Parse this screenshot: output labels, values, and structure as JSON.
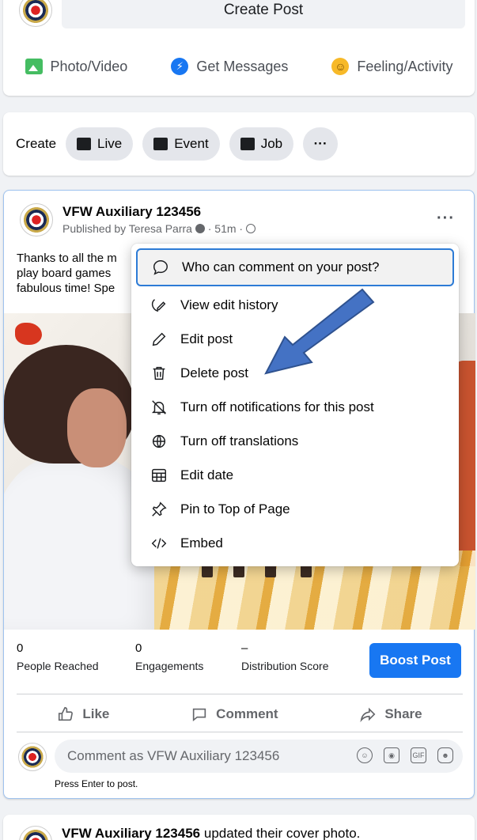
{
  "create_card": {
    "title": "Create Post",
    "actions": [
      {
        "label": "Photo/Video",
        "icon": "photo-icon"
      },
      {
        "label": "Get Messages",
        "icon": "messenger-icon"
      },
      {
        "label": "Feeling/Activity",
        "icon": "smiley-icon"
      }
    ]
  },
  "create_row": {
    "label": "Create",
    "pills": [
      {
        "label": "Live",
        "icon": "live-video-icon"
      },
      {
        "label": "Event",
        "icon": "calendar-icon"
      },
      {
        "label": "Job",
        "icon": "briefcase-icon"
      }
    ],
    "more": "···"
  },
  "post": {
    "author": "VFW Auxiliary 123456",
    "meta": "Published by Teresa Parra",
    "time": "51m",
    "more": "···",
    "text_lines": [
      "Thanks to all the m",
      "play board games",
      "fabulous time! Spe"
    ],
    "stats": [
      {
        "value": "0",
        "label": "People Reached"
      },
      {
        "value": "0",
        "label": "Engagements"
      },
      {
        "value": "–",
        "label": "Distribution Score"
      }
    ],
    "boost_label": "Boost Post",
    "reactions": [
      "Like",
      "Comment",
      "Share"
    ],
    "comment_placeholder": "Comment as VFW Auxiliary 123456",
    "enter_hint": "Press Enter to post."
  },
  "menu": {
    "items": [
      {
        "label": "Who can comment on your post?",
        "icon": "comment-bubble-icon"
      },
      {
        "label": "View edit history",
        "icon": "history-icon"
      },
      {
        "label": "Edit post",
        "icon": "pencil-icon"
      },
      {
        "label": "Delete post",
        "icon": "trash-icon"
      },
      {
        "label": "Turn off notifications for this post",
        "icon": "bell-off-icon"
      },
      {
        "label": "Turn off translations",
        "icon": "globe-icon"
      },
      {
        "label": "Edit date",
        "icon": "calendar-icon"
      },
      {
        "label": "Pin to Top of Page",
        "icon": "pin-icon"
      },
      {
        "label": "Embed",
        "icon": "code-icon"
      }
    ]
  },
  "next_post": {
    "author": "VFW Auxiliary 123456",
    "action": "updated their cover photo."
  },
  "colors": {
    "brand_blue": "#1877f2",
    "arrow_blue": "#4472c4"
  }
}
